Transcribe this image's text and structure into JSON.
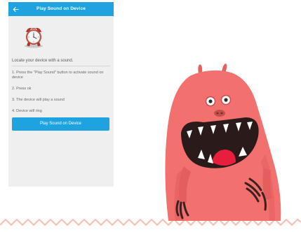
{
  "app_bar": {
    "title": "Play Sound on Device",
    "back_icon": "arrow-left-icon",
    "color": "#1ea3e0"
  },
  "content": {
    "illustration_icon": "alarm-clock-icon",
    "intro": "Locate your device with a sound.",
    "steps": [
      "1. Press the \"Play Sound\" button to activate sound on device",
      "2. Press ok",
      "3. The device will play a sound",
      "4. Device will ring"
    ],
    "button_label": "Play Sound on Device"
  },
  "illustration": {
    "subject": "pink-monster",
    "body_color": "#f2716e",
    "zigzag_color": "#f7c0b4"
  }
}
